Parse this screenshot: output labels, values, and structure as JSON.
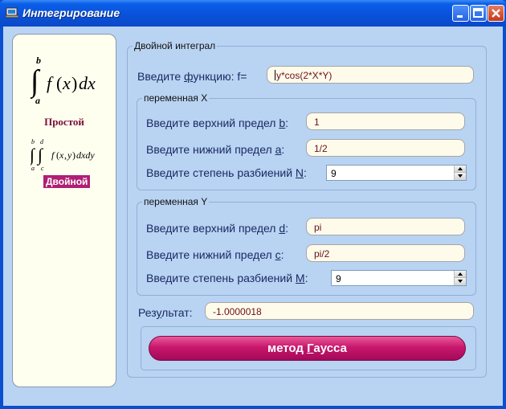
{
  "window": {
    "title": "Интегрирование",
    "icon": "app-window-icon",
    "controls": [
      "minimize-icon",
      "maximize-icon",
      "close-icon"
    ]
  },
  "left_panel": {
    "simple_label": "Простой",
    "double_label": "Двойной"
  },
  "main": {
    "group_title": "Двойной интеграл",
    "function_label_pre": "Введите ",
    "function_label_u": "ф",
    "function_label_post": "ункцию: f=",
    "function_value": "y*cos(2*X*Y)",
    "var_x": {
      "title": "переменная X",
      "upper_pre": "Введите верхний предел ",
      "upper_u": "b",
      "upper_post": ":",
      "upper_value": "1",
      "lower_pre": "Введите нижний предел ",
      "lower_u": "a",
      "lower_post": ":",
      "lower_value": "1/2",
      "n_pre": "Введите степень разбиений ",
      "n_u": "N",
      "n_post": ":",
      "n_value": "9"
    },
    "var_y": {
      "title": "переменная Y",
      "upper_pre": "Введите верхний предел ",
      "upper_u": "d",
      "upper_post": ":",
      "upper_value": "pi",
      "lower_pre": "Введите нижний предел ",
      "lower_u": "c",
      "lower_post": ":",
      "lower_value": "pi/2",
      "m_pre": "Введите степень разбиений  ",
      "m_u": "M",
      "m_post": ":",
      "m_value": "9"
    },
    "result_pre": "Рез",
    "result_u": "у",
    "result_post": "льтат:",
    "result_value": "-1.0000018",
    "gauss_pre": "метод ",
    "gauss_u": "Г",
    "gauss_post": "аусса"
  }
}
